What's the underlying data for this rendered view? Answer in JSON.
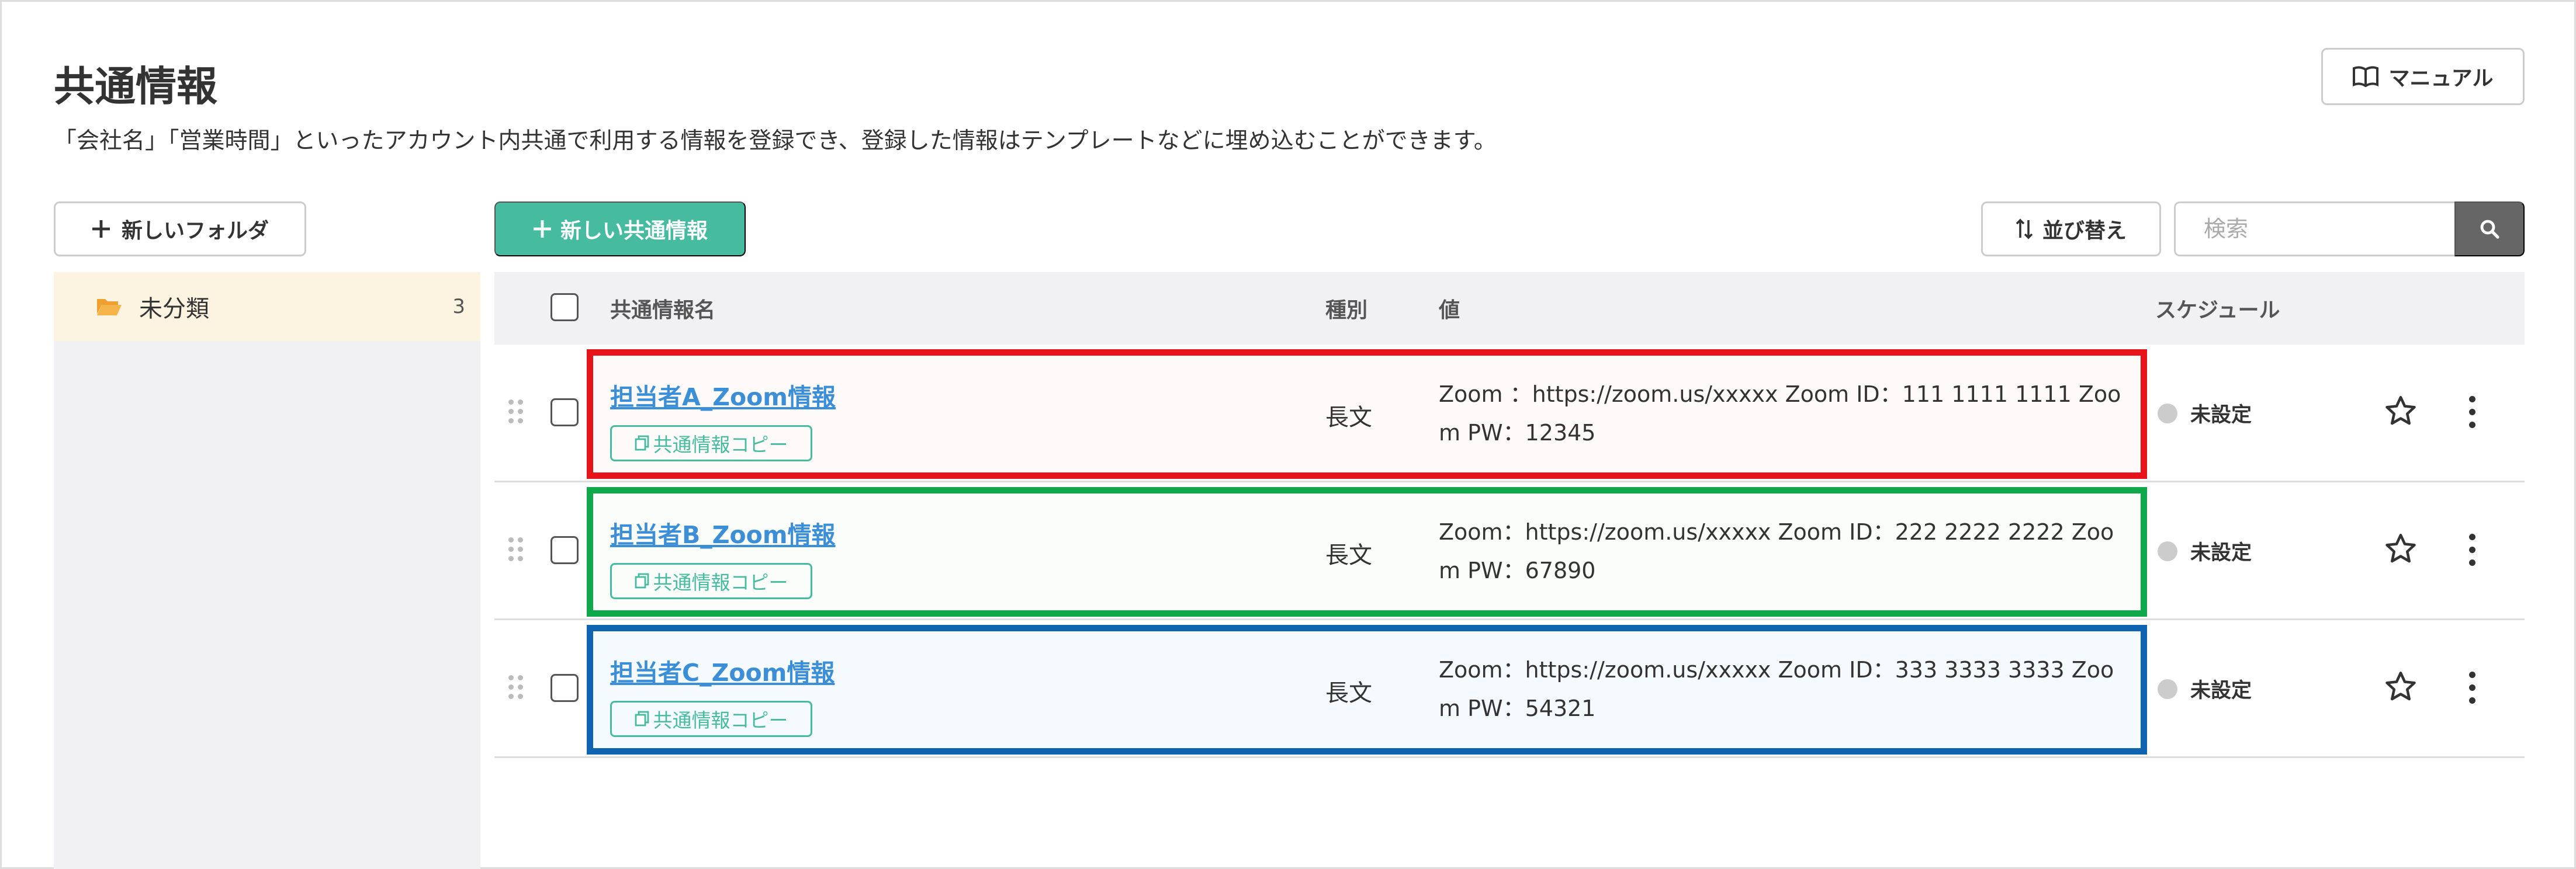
{
  "page": {
    "title": "共通情報",
    "description": "「会社名」「営業時間」といったアカウント内共通で利用する情報を登録でき、登録した情報はテンプレートなどに埋め込むことができます。"
  },
  "toolbar": {
    "manual_label": "マニュアル",
    "new_folder_label": "新しいフォルダ",
    "new_item_label": "新しい共通情報",
    "sort_label": "並び替え",
    "search_placeholder": "検索"
  },
  "sidebar": {
    "folders": [
      {
        "label": "未分類",
        "count": "3"
      }
    ]
  },
  "table": {
    "headers": {
      "name": "共通情報名",
      "type": "種別",
      "value": "値",
      "schedule": "スケジュール"
    },
    "rows": [
      {
        "name": "担当者A_Zoom情報",
        "copy_label": "共通情報コピー",
        "type": "長文",
        "value": "Zoom ：https://zoom.us/xxxxx Zoom ID：111 1111 1111 Zoom PW：12345",
        "schedule": "未設定",
        "highlight_color": "#e8141b",
        "highlight_bg": "#fffafa"
      },
      {
        "name": "担当者B_Zoom情報",
        "copy_label": "共通情報コピー",
        "type": "長文",
        "value": "Zoom：https://zoom.us/xxxxx Zoom ID：222 2222 2222 Zoom PW：67890",
        "schedule": "未設定",
        "highlight_color": "#0fa84a",
        "highlight_bg": "#fafdfa"
      },
      {
        "name": "担当者C_Zoom情報",
        "copy_label": "共通情報コピー",
        "type": "長文",
        "value": "Zoom：https://zoom.us/xxxxx Zoom ID：333 3333 3333 Zoom PW：54321",
        "schedule": "未設定",
        "highlight_color": "#0f63b0",
        "highlight_bg": "#f5fafe"
      }
    ]
  },
  "colors": {
    "accent_green": "#47bb9f",
    "link_blue": "#3c8fd6",
    "folder_orange": "#f0a030"
  },
  "icons": {
    "manual": "book-icon",
    "new_folder": "plus-icon",
    "new_item": "plus-icon",
    "sort": "sort-arrows-icon",
    "search": "search-icon",
    "folder": "folder-open-icon",
    "row_drag": "drag-handle-icon",
    "row_favorite": "star-icon",
    "row_menu": "kebab-menu-icon",
    "copy": "copy-icon"
  }
}
